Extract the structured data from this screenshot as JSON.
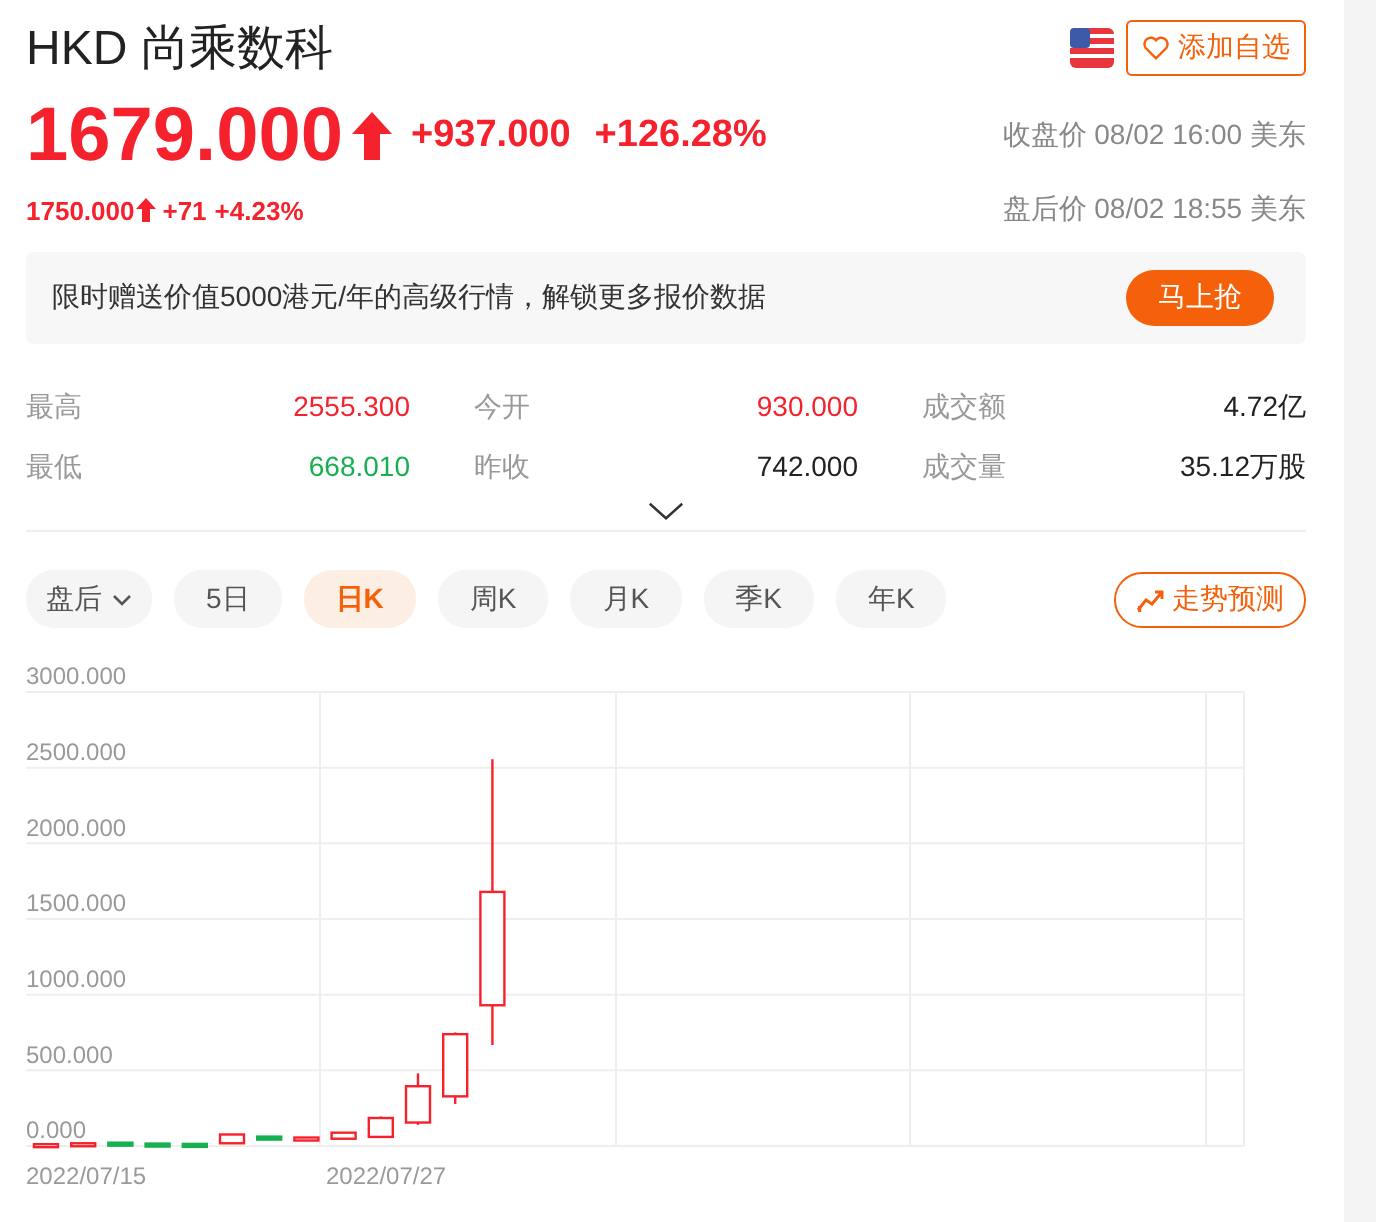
{
  "header": {
    "title": "HKD 尚乘数科",
    "watch_button": "添加自选"
  },
  "quote": {
    "price": "1679.000",
    "change": "+937.000",
    "change_pct": "+126.28%",
    "close_time": "收盘价 08/02 16:00 美东",
    "after_price": "1750.000",
    "after_change": "+71",
    "after_change_pct": "+4.23%",
    "after_time": "盘后价 08/02 18:55 美东"
  },
  "banner": {
    "text": "限时赠送价值5000港元/年的高级行情，解锁更多报价数据",
    "button": "马上抢"
  },
  "stats": [
    {
      "label": "最高",
      "value": "2555.300",
      "color": "#f5222d"
    },
    {
      "label": "今开",
      "value": "930.000",
      "color": "#f5222d"
    },
    {
      "label": "成交额",
      "value": "4.72亿",
      "color": "#222222"
    },
    {
      "label": "最低",
      "value": "668.010",
      "color": "#16b050"
    },
    {
      "label": "昨收",
      "value": "742.000",
      "color": "#222222"
    },
    {
      "label": "成交量",
      "value": "35.12万股",
      "color": "#222222"
    }
  ],
  "tabs": [
    {
      "label": "盘后",
      "kind": "dropdown",
      "selected": false
    },
    {
      "label": "5日",
      "kind": "plain",
      "selected": false
    },
    {
      "label": "日K",
      "kind": "plain",
      "selected": true
    },
    {
      "label": "周K",
      "kind": "plain",
      "selected": false
    },
    {
      "label": "月K",
      "kind": "plain",
      "selected": false
    },
    {
      "label": "季K",
      "kind": "plain",
      "selected": false
    },
    {
      "label": "年K",
      "kind": "plain",
      "selected": false
    }
  ],
  "forecast_button": "走势预测",
  "chart": {
    "y_labels": [
      "3000.000",
      "2500.000",
      "2000.000",
      "1500.000",
      "1000.000",
      "500.000",
      "0.000"
    ],
    "x_labels": [
      "2022/07/15",
      "2022/07/27"
    ]
  }
}
